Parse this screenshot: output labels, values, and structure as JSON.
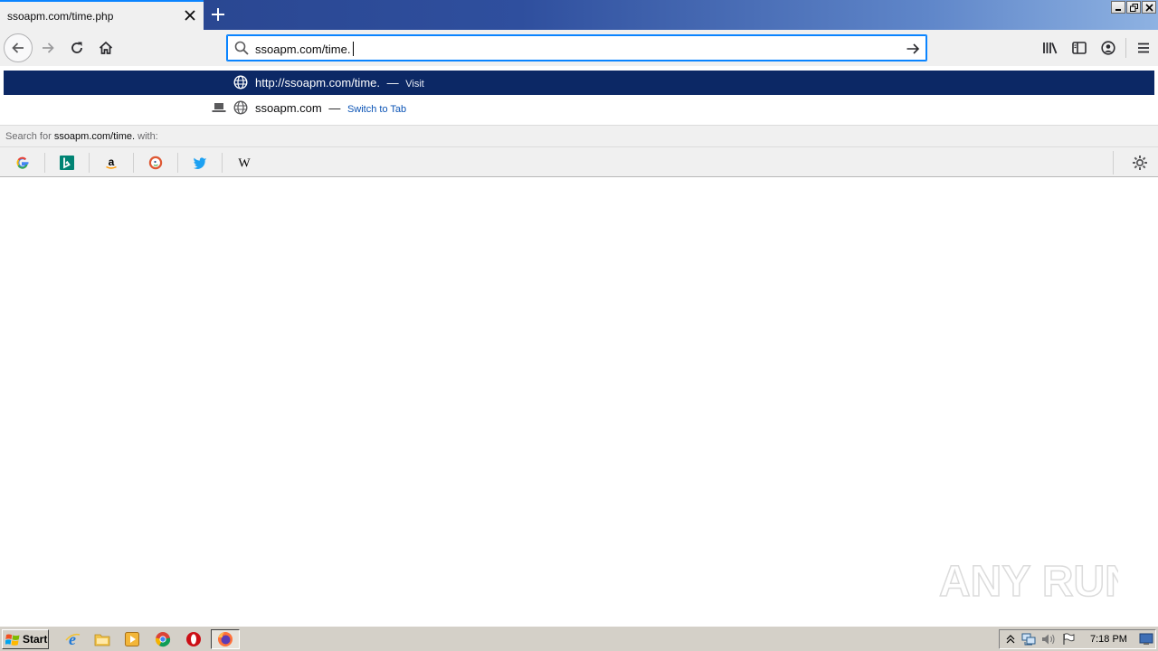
{
  "tab": {
    "title": "ssoapm.com/time.php"
  },
  "urlbar": {
    "value": "ssoapm.com/time."
  },
  "suggestions": [
    {
      "text": "http://ssoapm.com/time.",
      "action": "Visit"
    },
    {
      "text": "ssoapm.com",
      "action": "Switch to Tab"
    }
  ],
  "search_with": {
    "prefix": "Search for",
    "query": "ssoapm.com/time.",
    "suffix": "with:"
  },
  "search_engines": [
    {
      "name": "google",
      "glyph": "G",
      "color": "#4285f4"
    },
    {
      "name": "bing",
      "glyph": "b",
      "color": "#008373"
    },
    {
      "name": "amazon",
      "glyph": "a",
      "color": "#000000"
    },
    {
      "name": "duckduckgo",
      "glyph": "D",
      "color": "#de5833"
    },
    {
      "name": "twitter",
      "glyph": "t",
      "color": "#1da1f2"
    },
    {
      "name": "wikipedia",
      "glyph": "W",
      "color": "#000000"
    }
  ],
  "taskbar": {
    "start_label": "Start",
    "clock": "7:18 PM"
  },
  "watermark": {
    "text": "ANY RUN"
  },
  "colors": {
    "accent": "#0a84ff",
    "selected_row": "#0c2865",
    "taskbar": "#d4d0c8"
  }
}
